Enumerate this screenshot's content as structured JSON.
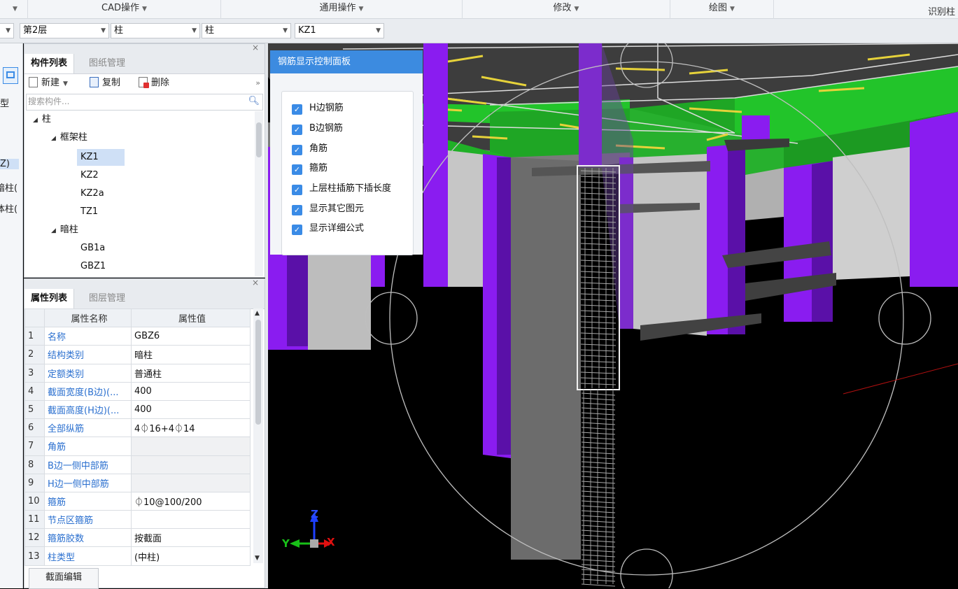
{
  "ribbon": {
    "groups": [
      {
        "label": "CAD操作",
        "caret": "▼"
      },
      {
        "label": "通用操作",
        "caret": "▼"
      },
      {
        "label": "修改",
        "caret": "▼"
      },
      {
        "label": "绘图",
        "caret": "▼"
      },
      {
        "label": "识别柱",
        "caret": ""
      }
    ],
    "first_caret": "▼"
  },
  "selectors": {
    "floor": "第2层",
    "category": "柱",
    "type": "柱",
    "component": "KZ1"
  },
  "left_strip": {
    "labels": [
      "型",
      "Z)",
      "暗柱(",
      "体柱("
    ]
  },
  "component_panel": {
    "tabs": [
      "构件列表",
      "图纸管理"
    ],
    "toolbar": {
      "new": "新建",
      "copy": "复制",
      "delete": "删除",
      "more": "»"
    },
    "search_placeholder": "搜索构件...",
    "tree": [
      {
        "label": "柱",
        "level": 0,
        "expanded": true
      },
      {
        "label": "框架柱",
        "level": 1,
        "expanded": true
      },
      {
        "label": "KZ1",
        "level": 2,
        "selected": true
      },
      {
        "label": "KZ2",
        "level": 2
      },
      {
        "label": "KZ2a",
        "level": 2
      },
      {
        "label": "TZ1",
        "level": 2
      },
      {
        "label": "暗柱",
        "level": 1,
        "expanded": true
      },
      {
        "label": "GB1a",
        "level": 2
      },
      {
        "label": "GBZ1",
        "level": 2
      }
    ]
  },
  "property_panel": {
    "tabs": [
      "属性列表",
      "图层管理"
    ],
    "columns": [
      "属性名称",
      "属性值"
    ],
    "rows": [
      {
        "num": "1",
        "name": "名称",
        "value": "GBZ6"
      },
      {
        "num": "2",
        "name": "结构类别",
        "value": "暗柱"
      },
      {
        "num": "3",
        "name": "定额类别",
        "value": "普通柱"
      },
      {
        "num": "4",
        "name": "截面宽度(B边)(...",
        "value": "400"
      },
      {
        "num": "5",
        "name": "截面高度(H边)(...",
        "value": "400"
      },
      {
        "num": "6",
        "name": "全部纵筋",
        "value": "4⏀16+4⏀14"
      },
      {
        "num": "7",
        "name": "角筋",
        "value": ""
      },
      {
        "num": "8",
        "name": "B边一侧中部筋",
        "value": ""
      },
      {
        "num": "9",
        "name": "H边一侧中部筋",
        "value": ""
      },
      {
        "num": "10",
        "name": "箍筋",
        "value": "⏀10@100/200"
      },
      {
        "num": "11",
        "name": "节点区箍筋",
        "value": ""
      },
      {
        "num": "12",
        "name": "箍筋胶数",
        "value": "按截面"
      },
      {
        "num": "13",
        "name": "柱类型",
        "value": "(中柱)"
      }
    ],
    "section_edit_button": "截面编辑"
  },
  "rebar_panel": {
    "title": "钢筋显示控制面板",
    "options": [
      {
        "label": "H边钢筋",
        "checked": true
      },
      {
        "label": "B边钢筋",
        "checked": true
      },
      {
        "label": "角筋",
        "checked": true
      },
      {
        "label": "箍筋",
        "checked": true
      },
      {
        "label": "上层柱插筋下插长度",
        "checked": true
      },
      {
        "label": "显示其它图元",
        "checked": true
      },
      {
        "label": "显示详细公式",
        "checked": true
      }
    ]
  },
  "axes": {
    "x": "X",
    "y": "Y",
    "z": "Z"
  },
  "colors": {
    "accent": "#3c8be0",
    "column_purple": "#8a1cf0",
    "beam_green": "#22c42a",
    "rebar_yellow": "#e6d23a",
    "slab_dark": "#3a3a3a",
    "link_blue": "#2a6fcf"
  }
}
